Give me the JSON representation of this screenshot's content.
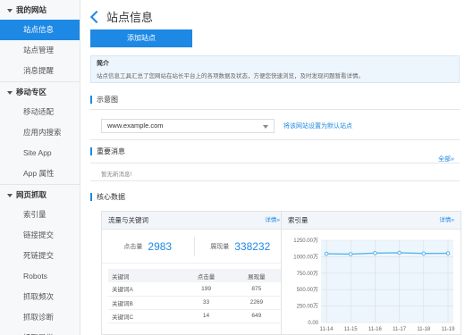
{
  "sidebar": {
    "sections": [
      {
        "title": "我的网站",
        "items": [
          "站点信息",
          "站点管理",
          "消息提醒"
        ]
      },
      {
        "title": "移动专区",
        "items": [
          "移动适配",
          "应用内搜索",
          "Site App",
          "App 属性"
        ]
      },
      {
        "title": "网页抓取",
        "items": [
          "索引量",
          "链接提交",
          "死链提交",
          "Robots",
          "抓取频次",
          "抓取诊断",
          "抓取异常"
        ]
      }
    ],
    "active_item": "站点信息"
  },
  "page": {
    "title": "站点信息",
    "add_site_button": "添加站点",
    "intro_title": "简介",
    "intro_text": "站点信息工具汇总了您网站在站长平台上的各项数据及状态，方便您快速浏览，及时发现问题暂看详情。"
  },
  "demo_site": {
    "section_title": "示意图",
    "select_value": "www.example.com",
    "set_default_link": "将该网站设置为默认站点"
  },
  "messages": {
    "section_title": "重要消息",
    "all_link": "全部»",
    "empty_text": "暂无新消息!"
  },
  "core": {
    "section_title": "核心数据",
    "traffic_card": {
      "title": "流量与关键词",
      "detail_link": "详情»",
      "clicks_label": "点击量",
      "clicks_value": "2983",
      "impressions_label": "展现量",
      "impressions_value": "338232",
      "table_headers": [
        "关键词",
        "点击量",
        "展现量"
      ],
      "rows": [
        [
          "关键词A",
          "199",
          "875"
        ],
        [
          "关键词B",
          "33",
          "2269"
        ],
        [
          "关键词C",
          "14",
          "649"
        ]
      ]
    },
    "index_card": {
      "title": "索引量",
      "detail_link": "详情»"
    }
  },
  "chart_data": {
    "type": "line",
    "title": "",
    "xlabel": "",
    "ylabel": "",
    "categories": [
      "11-14",
      "11-15",
      "11-16",
      "11-17",
      "11-18",
      "11-19"
    ],
    "series": [
      {
        "values": [
          1045,
          1040,
          1055,
          1060,
          1050,
          1052
        ]
      }
    ],
    "y_ticks": [
      "1250.00万",
      "1000.00万",
      "750.00万",
      "500.00万",
      "250.00万",
      "0.00"
    ],
    "y_tick_values": [
      1250,
      1000,
      750,
      500,
      250,
      0
    ],
    "ylim": [
      0,
      1250
    ],
    "grid": true,
    "line_color": "#5ab5e8"
  }
}
